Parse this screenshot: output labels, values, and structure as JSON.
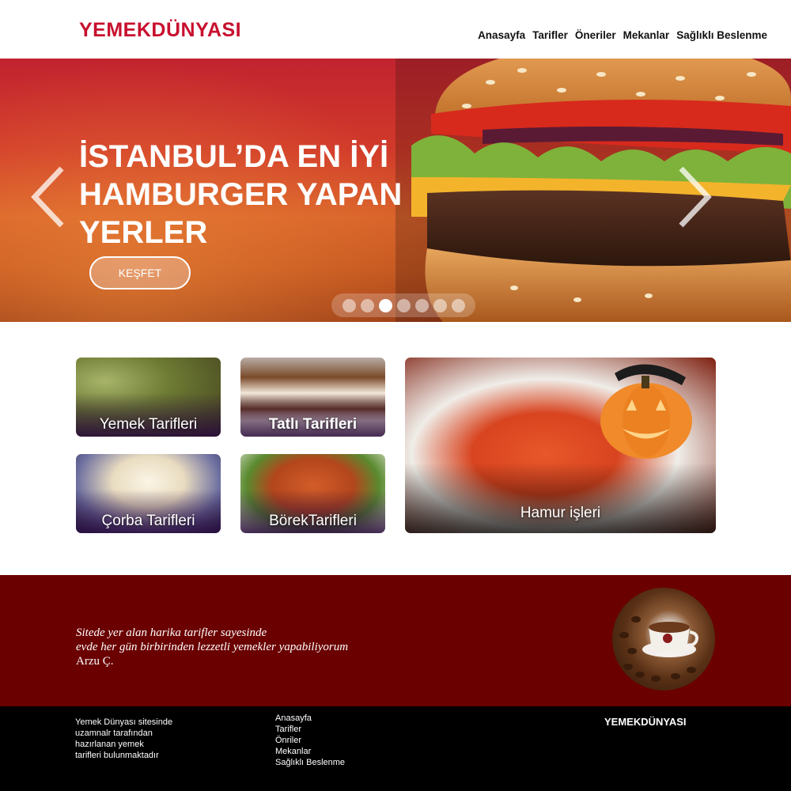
{
  "header": {
    "logo": "YEMEKDÜNYASI",
    "nav": [
      "Anasayfa",
      "Tarifler",
      "Öneriler",
      "Mekanlar",
      "Sağlıklı Beslenme"
    ]
  },
  "hero": {
    "title_lines": [
      "İSTANBUL’DA EN İYİ",
      "HAMBURGER YAPAN",
      "YERLER"
    ],
    "button_label": "KEŞFET",
    "slide_count": 7,
    "active_slide": 3
  },
  "categories": [
    {
      "label": "Yemek Tarifleri"
    },
    {
      "label": "Tatlı Tarifleri"
    },
    {
      "label": "Çorba Tarifleri"
    },
    {
      "label": "BörekTarifleri"
    },
    {
      "label": "Hamur işleri"
    }
  ],
  "testimonial": {
    "quote_line1": "Sitede yer alan harika tarifler sayesinde",
    "quote_line2": "evde her gün birbirinden lezzetli yemekler yapabiliyorum",
    "author": "Arzu Ç."
  },
  "footer": {
    "about_lines": [
      "Yemek Dünyası sitesinde",
      "uzamnalr tarafından",
      "hazırlanan yemek",
      "tarifleri bulunmaktadır"
    ],
    "links": [
      "Anasayfa",
      "Tarifler",
      "Önriler",
      "Mekanlar",
      "Sağlıklı Beslenme"
    ],
    "logo": "YEMEKDÜNYASI"
  },
  "colors": {
    "brand_red": "#c8102e",
    "testimonial_bg": "#6a0000",
    "footer_bg": "#000000"
  }
}
